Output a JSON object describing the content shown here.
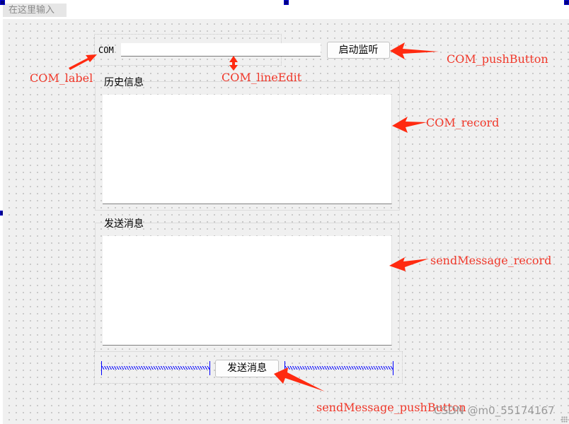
{
  "menubar": {
    "input_placeholder": "在这里输入"
  },
  "form": {
    "com_label": "COM",
    "com_lineedit_value": "",
    "com_pushbutton_label": "启动监听",
    "history_group_title": "历史信息",
    "history_record_text": "",
    "send_group_title": "发送消息",
    "send_record_text": "",
    "send_pushbutton_label": "发送消息"
  },
  "annotations": {
    "com_label": "COM_label",
    "com_lineedit": "COM_lineEdit",
    "com_pushbutton": "COM_pushButton",
    "com_record": "COM_record",
    "sendmessage_record": "sendMessage_record",
    "sendmessage_pushbutton": "sendMessage_pushButton",
    "color": "#f0382a"
  },
  "watermark": "CSDN @m0_55174167"
}
